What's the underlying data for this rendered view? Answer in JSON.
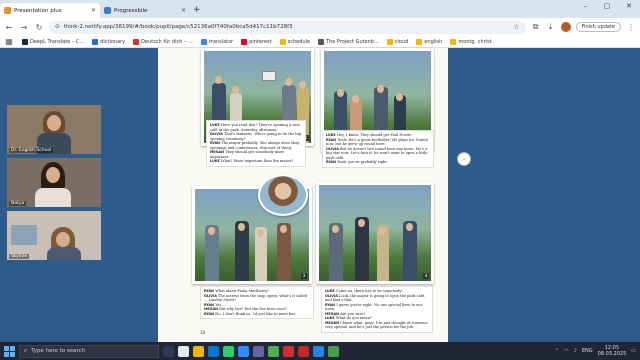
{
  "tabs": [
    {
      "title": "Presentation plus",
      "active": true
    },
    {
      "title": "Progressbile",
      "active": false
    }
  ],
  "address": {
    "url": "think-2.netlify.app/38199/#/book/pupil/page/c52136a0f740fa0bca5d417c11b728f3"
  },
  "finish_update_label": "Finish update",
  "bookmarks": [
    "DeepL Translate – C...",
    "dictionary",
    "Deutsch für dich – ...",
    "translator",
    "pinterest",
    "schedule",
    "The Project Gutenb...",
    "cloud",
    "english",
    "montg. christ"
  ],
  "participants": [
    {
      "label": "Dr. English School"
    },
    {
      "label": "Natya"
    },
    {
      "label": "Skyline"
    }
  ],
  "book": {
    "page_number": "18",
    "panels": [
      {
        "num": "1",
        "lines": [
          {
            "speaker": "LUKE",
            "text": "Have you read this? They're opening a new café in the park. Saturday afternoon."
          },
          {
            "speaker": "OLIVIA",
            "text": "That's fantastic. Who's going to do the big opening ceremony?"
          },
          {
            "speaker": "RYAN",
            "text": "The mayor probably. She always does shop openings and conferences, that sort of thing."
          },
          {
            "speaker": "MEGAN",
            "text": "They should get somebody more important."
          },
          {
            "speaker": "LUKE",
            "text": "What? More important than the mayor?"
          }
        ]
      },
      {
        "num": "2",
        "lines": [
          {
            "speaker": "LUKE",
            "text": "Hey, I know. They should get Paul Norris."
          },
          {
            "speaker": "RYAN",
            "text": "Yeah! He's a great footballer! He plays for United now, but he grew up round here."
          },
          {
            "speaker": "OLIVIA",
            "text": "But he doesn't live round here any more. He's a big star now. Let's face it, he won't want to open a little park café."
          },
          {
            "speaker": "RYAN",
            "text": "Yeah, you're probably right."
          }
        ]
      },
      {
        "num": "3",
        "lines": [
          {
            "speaker": "RYAN",
            "text": "What about Paula Marlberry?"
          },
          {
            "speaker": "OLIVIA",
            "text": "The actress from the soap opera, what's it called ... London Street?"
          },
          {
            "speaker": "RYAN",
            "text": "Yes ..."
          },
          {
            "speaker": "MEGAN",
            "text": "But why her? Did she live here once?"
          },
          {
            "speaker": "RYAN",
            "text": "No, I don't think so. I'd just like to meet her."
          }
        ]
      },
      {
        "num": "4",
        "lines": [
          {
            "speaker": "LUKE",
            "text": "Come on, there has to be somebody!"
          },
          {
            "speaker": "OLIVIA",
            "text": "Look, the mayor is going to open the park café, and that's that."
          },
          {
            "speaker": "RYAN",
            "text": "I guess you're right. No one special lives in our town."
          },
          {
            "speaker": "MEGAN",
            "text": "Are you sure?"
          },
          {
            "speaker": "LUKE",
            "text": "What do you mean?"
          },
          {
            "speaker": "MEGAN",
            "text": "I know what, guys! I've just thought of someone very special, and he's just the person for the job."
          }
        ]
      }
    ]
  },
  "taskbar": {
    "search_placeholder": "Type here to search",
    "language": "ENG",
    "time": "12:05",
    "date": "08.03.2025"
  },
  "colors": {
    "viewer_bg": "#2d5b8c",
    "taskbar_bg": "#202635",
    "tab_bar": "#d9e4f1"
  }
}
